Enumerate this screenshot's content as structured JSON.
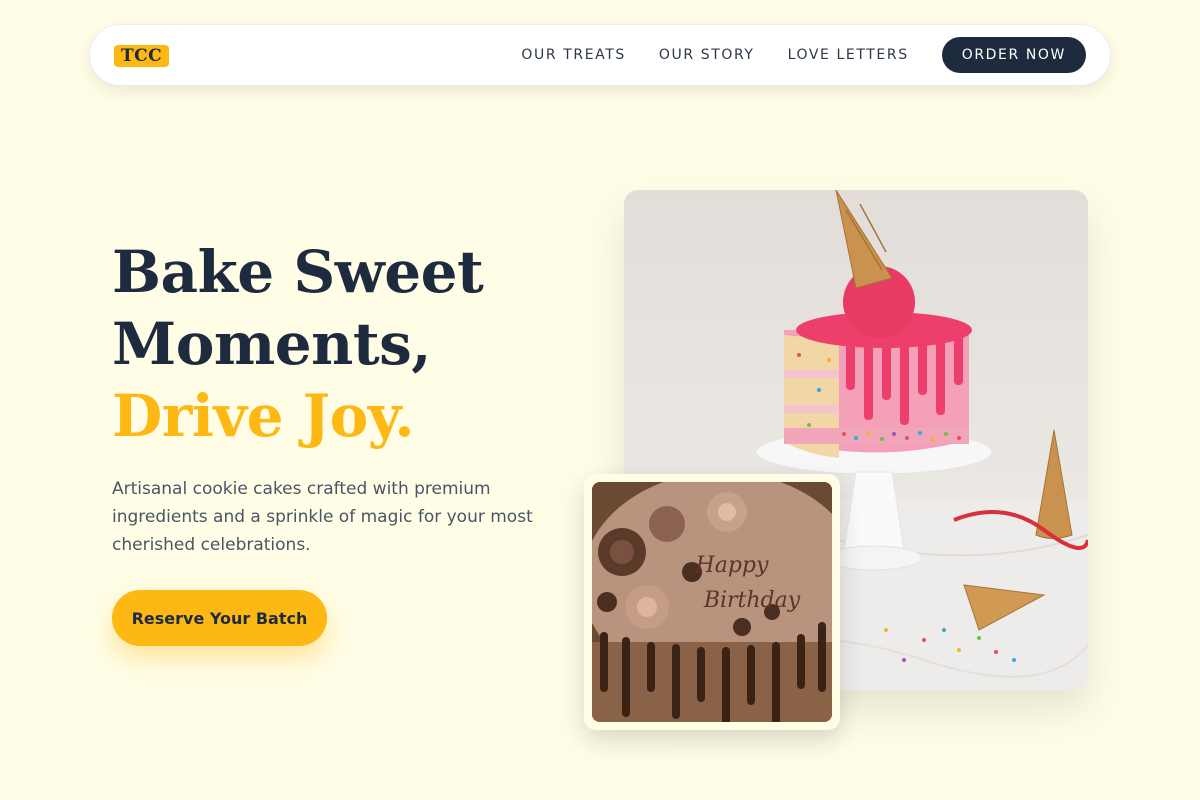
{
  "nav": {
    "logo": "TCC",
    "links": [
      "OUR TREATS",
      "OUR STORY",
      "LOVE LETTERS"
    ],
    "cta": "ORDER NOW"
  },
  "hero": {
    "headline_line1": "Bake Sweet",
    "headline_line2": "Moments,",
    "headline_accent": "Drive Joy.",
    "subtitle": "Artisanal cookie cakes crafted with premium ingredients and a sprinkle of magic for your most cherished celebrations.",
    "cta": "Reserve Your Batch"
  },
  "images": {
    "main": {
      "cake_text": ""
    },
    "small": {
      "icing_line1": "Happy",
      "icing_line2": "Birthday"
    }
  },
  "colors": {
    "background": "#fffde6",
    "accent": "#fdb813",
    "navy": "#1e2a3e",
    "body_text": "#4a5568"
  }
}
